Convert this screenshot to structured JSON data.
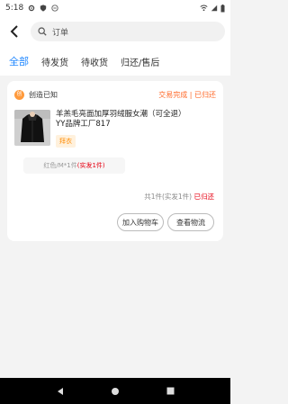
{
  "status_bar": {
    "time": "5:18"
  },
  "search": {
    "text": "订单"
  },
  "tabs": [
    {
      "label": "全部"
    },
    {
      "label": "待发货"
    },
    {
      "label": "待收货"
    },
    {
      "label": "归还/售后"
    }
  ],
  "order": {
    "shop_logo_text": "创",
    "shop_name": "创造已知",
    "status": "交易完成 | 已归还",
    "product_title": "羊羔毛亮面加厚羽绒服女潮（可全退）",
    "product_shop": "YY品牌工厂817",
    "tag": "拜衣",
    "spec_text": "红色/M*1件",
    "spec_qty": "(实发1件)",
    "summary_text": "共1件(实发1件)",
    "summary_status": "已归还",
    "btn_cart": "加入购物车",
    "btn_logistics": "查看物流"
  },
  "colors": {
    "accent": "#1e86ff",
    "status_orange": "#ff6a2a",
    "red": "#e60012"
  }
}
